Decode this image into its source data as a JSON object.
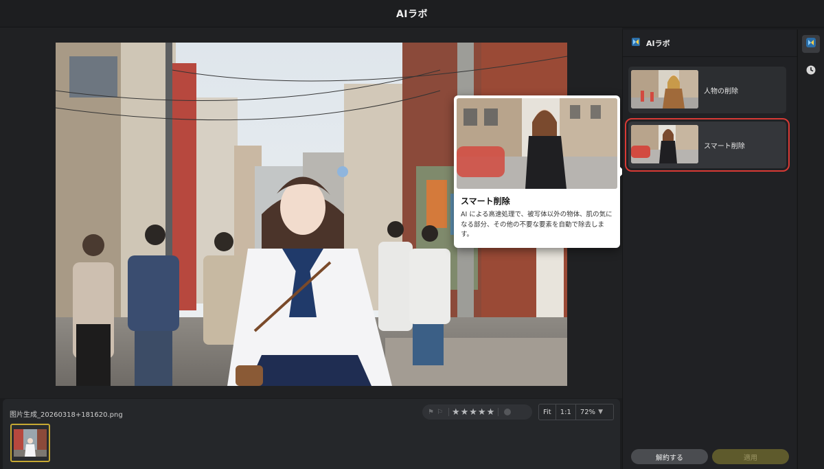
{
  "app": {
    "title": "AIラボ"
  },
  "colors": {
    "accent": "#c7a933",
    "selection_border": "#d93a35",
    "apply_button": "#5e5a2c"
  },
  "tooltip": {
    "title": "スマート削除",
    "description": "AI による高速処理で、被写体以外の物体、肌の気になる部分、その他の不要な要素を自動で除去します。"
  },
  "bottombar": {
    "filename": "图片生成_20260318+181620.png",
    "rating": {
      "stars": 5
    },
    "zoom": {
      "fit": "Fit",
      "one_to_one": "1:1",
      "percent": "72%"
    }
  },
  "panel": {
    "title": "AIラボ",
    "features": [
      {
        "label": "人物の削除",
        "selected": false
      },
      {
        "label": "スマート削除",
        "selected": true
      }
    ],
    "cancel_label": "解約する",
    "apply_label": "適用"
  },
  "rail": {
    "icons": [
      "ai-lab-icon",
      "history-clock-icon"
    ]
  }
}
